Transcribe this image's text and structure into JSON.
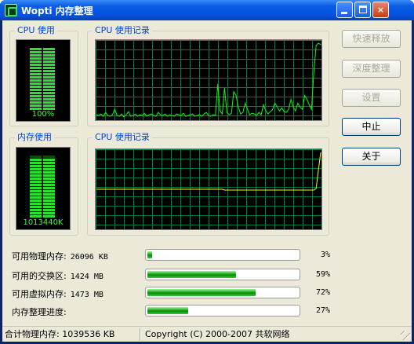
{
  "window": {
    "title": "Wopti 内存整理",
    "controls": {
      "minimize": "minimize-button",
      "maximize": "maximize-button",
      "close": "×"
    }
  },
  "cpu_usage": {
    "title": "CPU 使用",
    "value": "100%",
    "level": 1.0
  },
  "cpu_history": {
    "title": "CPU 使用记录"
  },
  "memory_usage": {
    "title": "内存使用",
    "value": "1013440K",
    "level": 0.97
  },
  "memory_history": {
    "title": "CPU 使用记录"
  },
  "buttons": {
    "fast_release": "快速释放",
    "deep_clean": "深度整理",
    "settings": "设置",
    "stop": "中止",
    "about": "关于"
  },
  "stats": [
    {
      "label": "可用物理内存:",
      "value": "26096 KB",
      "percent": "3%",
      "fraction": 0.03
    },
    {
      "label": "可用的交换区:",
      "value": "1424 MB",
      "percent": "59%",
      "fraction": 0.59
    },
    {
      "label": "可用虚拟内存:",
      "value": "1473 MB",
      "percent": "72%",
      "fraction": 0.72
    },
    {
      "label": "内存整理进度:",
      "value": "",
      "percent": "27%",
      "fraction": 0.27
    }
  ],
  "status_bar": {
    "total_memory": "合计物理内存: 1039536 KB",
    "copyright": "Copyright (C) 2000-2007 共软网络"
  },
  "colors": {
    "titlebar": "#0454e3",
    "graph_grid": "#008040",
    "cpu_line": "#00ff00",
    "memory_line": "#ffff00",
    "meter_on": "#2fdf2f",
    "progress_fill": "#1ea51e"
  },
  "chart_data": [
    {
      "type": "line",
      "series": [
        {
          "values": [
            5,
            4,
            6,
            3,
            8,
            4,
            3,
            5,
            12,
            4,
            3,
            6,
            2,
            5,
            9,
            3,
            4,
            6,
            3,
            5,
            4,
            7,
            3,
            5,
            6,
            4,
            3,
            8,
            5,
            4,
            6,
            3,
            5,
            4,
            3,
            6,
            5,
            4,
            7,
            3,
            4,
            5,
            6,
            3,
            4,
            5,
            3,
            6,
            8,
            4,
            3,
            5,
            4,
            45,
            10,
            6,
            40,
            8,
            5,
            7,
            35,
            30,
            15,
            6,
            8,
            20,
            12,
            5,
            7,
            6,
            4,
            8,
            5,
            18,
            10,
            6,
            9,
            12,
            20,
            15,
            10,
            14,
            9,
            8,
            12,
            25,
            15,
            10,
            20,
            15,
            12,
            30,
            25,
            18,
            12,
            60,
            95,
            98,
            96
          ]
        }
      ],
      "ylim": [
        0,
        100
      ]
    },
    {
      "type": "line",
      "series": [
        {
          "values": [
            50,
            50,
            50,
            50,
            50,
            50,
            50,
            50,
            50,
            50,
            50,
            50,
            50,
            50,
            50,
            50,
            50,
            50,
            50,
            50,
            50,
            50,
            50,
            50,
            50,
            50,
            50,
            50,
            50,
            50,
            50,
            50,
            50,
            50,
            50,
            50,
            50,
            50,
            50,
            50,
            50,
            50,
            50,
            50,
            50,
            50,
            50,
            50,
            50,
            50,
            50,
            50,
            50,
            50,
            50,
            50,
            49,
            49,
            49,
            49,
            49,
            49,
            49,
            49,
            49,
            49,
            49,
            49,
            49,
            49,
            49,
            49,
            49,
            49,
            49,
            49,
            49,
            49,
            49,
            49,
            49,
            49,
            49,
            49,
            49,
            49,
            49,
            49,
            49,
            49,
            49,
            49,
            49,
            49,
            49,
            49,
            51,
            75,
            98
          ]
        }
      ],
      "ylim": [
        0,
        100
      ]
    }
  ]
}
